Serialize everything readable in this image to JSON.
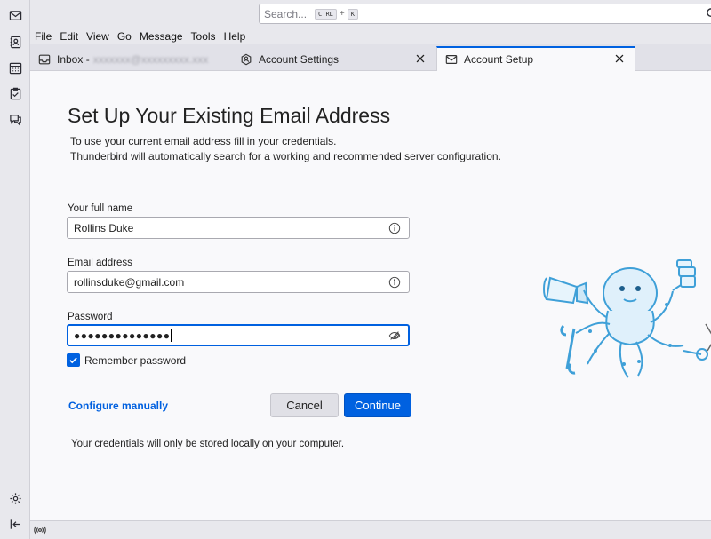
{
  "search": {
    "placeholder": "Search...",
    "shortcut_key1": "CTRL",
    "shortcut_plus": "+",
    "shortcut_key2": "K"
  },
  "menu": {
    "items": [
      {
        "label": "File"
      },
      {
        "label": "Edit"
      },
      {
        "label": "View"
      },
      {
        "label": "Go"
      },
      {
        "label": "Message"
      },
      {
        "label": "Tools"
      },
      {
        "label": "Help"
      }
    ]
  },
  "tabs": [
    {
      "label": "Inbox -",
      "blurred_text": "xxxxxxx@xxxxxxxxx.xxx",
      "icon": "inbox-icon"
    },
    {
      "label": "Account Settings",
      "icon": "account-settings-icon"
    },
    {
      "label": "Account Setup",
      "icon": "mail-icon",
      "active": true
    }
  ],
  "setup": {
    "title": "Set Up Your Existing Email Address",
    "intro_line1": "To use your current email address fill in your credentials.",
    "intro_line2": "Thunderbird will automatically search for a working and recommended server configuration.",
    "name_label": "Your full name",
    "name_value": "Rollins Duke",
    "email_label": "Email address",
    "email_value": "rollinsduke@gmail.com",
    "password_label": "Password",
    "password_value": "●●●●●●●●●●●●●●",
    "remember_label": "Remember password",
    "remember_checked": true,
    "configure_link": "Configure manually",
    "cancel_label": "Cancel",
    "continue_label": "Continue",
    "footnote": "Your credentials will only be stored locally on your computer."
  },
  "colors": {
    "accent": "#0061e0",
    "link": "#0060df",
    "mascot": "#3fa0d8"
  }
}
